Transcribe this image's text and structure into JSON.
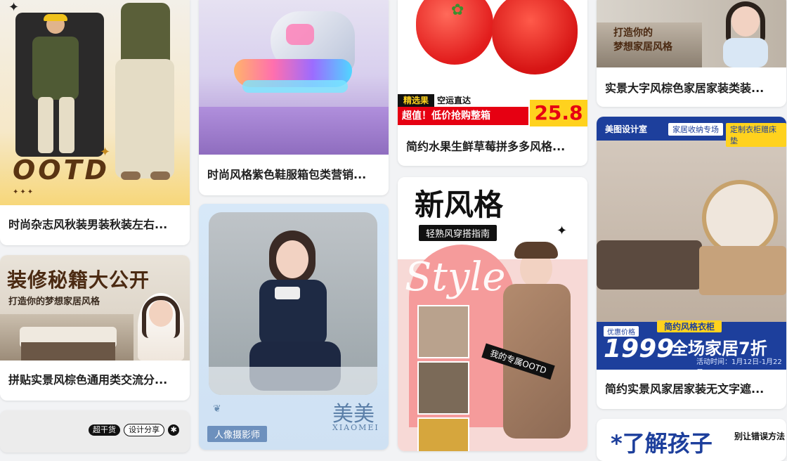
{
  "cards": {
    "c1": {
      "title": "时尚杂志风秋装男装秋装左右...",
      "overlay_text": "OOTD",
      "bg": "#f7d77a"
    },
    "c2": {
      "title": "拼贴实景风棕色通用类交流分...",
      "headline": "装修秘籍大公开",
      "subline": "打造你的梦想家居风格"
    },
    "c3": {
      "tag_1": "超干货",
      "tag_2": "设计分享"
    },
    "c4": {
      "title": "时尚风格紫色鞋服箱包类营销..."
    },
    "c5": {
      "brand_cn": "美美",
      "brand_en": "XIAOMEI",
      "label": "人像摄影师"
    },
    "c6": {
      "title": "简约水果生鲜草莓拼多多风格...",
      "strip_top_left": "精选果",
      "strip_top_right": "空运直达",
      "price_text": "超值！低价抢购整箱",
      "price": "25.8"
    },
    "c7": {
      "headline": "新风格",
      "subhead": "轻熟风穿搭指南",
      "script_word": "Style",
      "caption": "我的专属OOTD"
    },
    "c8": {
      "title": "实景大字风棕色家居家装类装...",
      "line_1": "打造你的",
      "line_2": "梦想家居风格"
    },
    "c9": {
      "title": "简约实景风家居家装无文字遮...",
      "brand": "美图设计室",
      "tab_1": "家居收纳专场",
      "tab_2": "定制衣柜赠床垫",
      "tag_small": "优惠价格",
      "tag_mid": "简约风格衣柜",
      "price": "1999",
      "headline": "全场家居7折",
      "date_label": "活动时间：",
      "date_range": "1月12日-1月22日"
    },
    "c10": {
      "big_text": "*了解孩子",
      "side_text": "别让错误方法"
    }
  },
  "colors": {
    "price_red": "#e60012",
    "yellow": "#ffd21e",
    "blue": "#1d3f9c",
    "pink": "#f59b9b"
  }
}
